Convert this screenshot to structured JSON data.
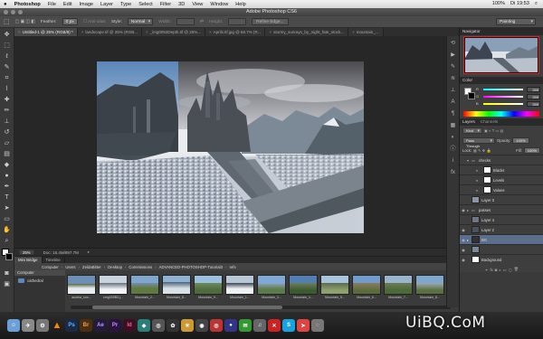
{
  "menubar": {
    "apple": "",
    "app": "Photoshop",
    "items": [
      "File",
      "Edit",
      "Image",
      "Layer",
      "Type",
      "Select",
      "Filter",
      "3D",
      "View",
      "Window",
      "Help"
    ],
    "status": [
      "100%",
      "Di 19:53"
    ]
  },
  "titlebar": {
    "title": "Adobe Photoshop CS6"
  },
  "options": {
    "feather_label": "Feather:",
    "feather_value": "0 px",
    "antialias": "Anti-alias",
    "style_label": "Style:",
    "style_value": "Normal",
    "width_label": "Width:",
    "height_label": "Height:",
    "refine": "Refine Edge...",
    "workspace": "Painting"
  },
  "doc_tabs": [
    "Untitled-1 @ 25% (RGB/8) *",
    "landscape.tif @ 25% (RGB...",
    "_img0053Depth.tif @ 25%...",
    "Aprils.tif.jpg @ 66.7% (R...",
    "stormy_sunrays_by_night_fate_stock...",
    "mountain_..."
  ],
  "status": {
    "zoom": "25%",
    "doc": "Doc: 15.4M/897.7M"
  },
  "mini_bridge": {
    "tabs": [
      "Mini Bridge",
      "Timeline"
    ],
    "path": [
      "Computer",
      "Users",
      "ZeldaBitter",
      "Desktop",
      "Commissions",
      "ADVANCED-PHOTOSHOP-Tutorial3",
      "refs"
    ],
    "left_header": "Computer",
    "left_item": "cathedral",
    "thumbs": [
      "austria_sno...",
      "cmg009B3.j...",
      "Mountain_2...",
      "Mountain_8...",
      "Mountain_9...",
      "Mountain_1...",
      "Mountain_3...",
      "Mountain_4...",
      "Mountain_5...",
      "Mountain_6...",
      "Mountain_7...",
      "Mountain_8..."
    ]
  },
  "panels": {
    "navigator": "Navigator",
    "color": "Color",
    "rgb": [
      {
        "label": "R",
        "value": "255"
      },
      {
        "label": "G",
        "value": "255"
      },
      {
        "label": "B",
        "value": "255"
      }
    ],
    "layers_tabs": [
      "Layers",
      "Channels"
    ],
    "kind": "Kind",
    "blend": "Pass Through",
    "opacity_label": "Opacity:",
    "opacity_value": "100%",
    "lock_label": "Lock:",
    "fill_label": "Fill:",
    "fill_value": "100%",
    "layers": [
      {
        "name": "checks",
        "type": "group"
      },
      {
        "name": "Blacks",
        "type": "adj"
      },
      {
        "name": "Levels",
        "type": "adj"
      },
      {
        "name": "Values",
        "type": "adj"
      },
      {
        "name": "Layer 3",
        "type": "img"
      },
      {
        "name": "passes",
        "type": "group"
      },
      {
        "name": "Layer 4",
        "type": "img"
      },
      {
        "name": "Layer 2",
        "type": "img"
      },
      {
        "name": "BG",
        "type": "sel"
      },
      {
        "name": "",
        "type": "img"
      },
      {
        "name": "Background",
        "type": "bg"
      }
    ]
  },
  "watermark": "UiBQ.CoM"
}
